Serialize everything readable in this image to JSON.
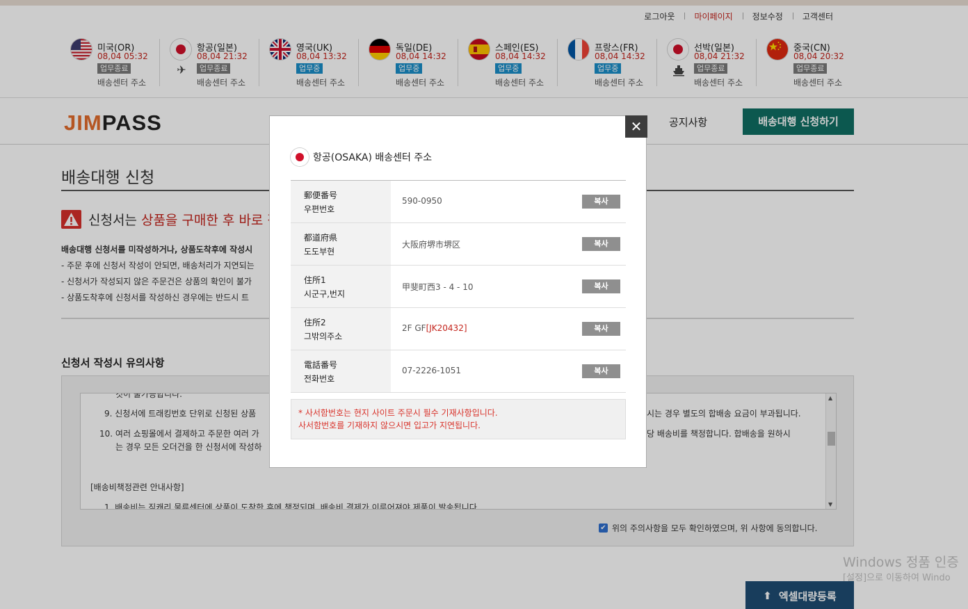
{
  "top_links": [
    "로그아웃",
    "마이페이지",
    "정보수정",
    "고객센터"
  ],
  "centers": [
    {
      "name": "미국(OR)",
      "time": "08,04 05:32",
      "status": "업무종료",
      "status_type": "off",
      "addr": "배송센터 주소",
      "flag": "us-flag-icon",
      "mode": ""
    },
    {
      "name": "항공(일본)",
      "time": "08,04 21:32",
      "status": "업무종료",
      "status_type": "off",
      "addr": "배송센터 주소",
      "flag": "jp-flag-icon",
      "mode": "airplane-icon"
    },
    {
      "name": "영국(UK)",
      "time": "08,04 13:32",
      "status": "업무중",
      "status_type": "on",
      "addr": "배송센터 주소",
      "flag": "uk-flag-icon",
      "mode": ""
    },
    {
      "name": "독일(DE)",
      "time": "08,04 14:32",
      "status": "업무중",
      "status_type": "on",
      "addr": "배송센터 주소",
      "flag": "de-flag-icon",
      "mode": ""
    },
    {
      "name": "스페인(ES)",
      "time": "08,04 14:32",
      "status": "업무중",
      "status_type": "on",
      "addr": "배송센터 주소",
      "flag": "es-flag-icon",
      "mode": ""
    },
    {
      "name": "프랑스(FR)",
      "time": "08,04 14:32",
      "status": "업무중",
      "status_type": "on",
      "addr": "배송센터 주소",
      "flag": "fr-flag-icon",
      "mode": ""
    },
    {
      "name": "선박(일본)",
      "time": "08,04 21:32",
      "status": "업무종료",
      "status_type": "off",
      "addr": "배송센터 주소",
      "flag": "jp-flag-icon",
      "mode": "ship-icon"
    },
    {
      "name": "중국(CN)",
      "time": "08,04 20:32",
      "status": "업무종료",
      "status_type": "off",
      "addr": "배송센터 주소",
      "flag": "cn-flag-icon",
      "mode": ""
    }
  ],
  "logo": {
    "part1": "JIM",
    "part2": "PASS"
  },
  "nav": {
    "notice": "공지사항",
    "apply": "배송대행 신청하기"
  },
  "page_title": "배송대행 신청",
  "warning": {
    "prefix": "신청서는 ",
    "highlight": "상품을 구매한 후 바로 작"
  },
  "notes": [
    "배송대행 신청서를 미작성하거나, 상품도착후에 작성시",
    "- 주문 후에 신청서 작성이 안되면, 배송처리가 지연되는",
    "- 신청서가 작성되지 않은 주문건은 상품의 확인이 불가",
    "- 상품도착후에 신청서를 작성하신 경우에는 반드시 트"
  ],
  "section_title": "신청서 작성시 유의사항",
  "terms": {
    "cut_line": "것이 불가능합니다.",
    "item9": {
      "num": "9.",
      "text": "신청서에 트래킹번호 단위로 신청된 상품",
      "tail": "시는 경우 별도의 합배송 요금이 부과됩니다."
    },
    "item10": {
      "num": "10.",
      "text": "여러 쇼핑몰에서 결제하고 주문한 여러 가",
      "tail": "당 배송비를 책정합니다. 합배송을 원하시"
    },
    "item10_cont": "는 경우 모든 오더건을 한 신청서에 작성하",
    "heading": "[배송비책정관련 안내사항]",
    "item1": {
      "num": "1.",
      "text": "배송비는 짐캐리 물류센터에 상품이 도착한 후에 책정되며, 배송비 결제가 이루어져야 제품이 발송됩니다"
    }
  },
  "agree_text": "위의 주의사항을 모두 확인하였으며, 위 사항에 동의합니다.",
  "watermark": {
    "line1": "Windows 정품 인증",
    "line2": "[설정]으로 이동하여 Windo"
  },
  "excel_button": "엑셀대량등록",
  "modal": {
    "title": "항공(OSAKA) 배송센터 주소",
    "flag": "jp-flag-icon",
    "close": "✕",
    "rows": [
      {
        "label_jp": "郵便番号",
        "label_kr": "우편번호",
        "value": "590-0950",
        "code": "",
        "copy": "복사"
      },
      {
        "label_jp": "都道府県",
        "label_kr": "도도부현",
        "value": "大阪府堺市堺区",
        "code": "",
        "copy": "복사"
      },
      {
        "label_jp": "住所1",
        "label_kr": "시군구,번지",
        "value": "甲斐町西3 - 4 - 10",
        "code": "",
        "copy": "복사"
      },
      {
        "label_jp": "住所2",
        "label_kr": "그밖의주소",
        "value": "2F GF",
        "code": "[JK20432]",
        "copy": "복사"
      },
      {
        "label_jp": "電話番号",
        "label_kr": "전화번호",
        "value": "07-2226-1051",
        "code": "",
        "copy": "복사"
      }
    ],
    "note_line1": "* 사서함번호는 현지 사이트 주문시 필수 기재사항입니다.",
    "note_line2": "사서함번호를 기재하지 않으시면 입고가 지연됩니다."
  },
  "colors": {
    "accent_red": "#c4241c",
    "status_on": "#1a8ec9",
    "status_off": "#7a7a7a",
    "apply_button": "#0f6e63",
    "excel_button": "#1e4d73",
    "logo_orange": "#e36c2c"
  }
}
